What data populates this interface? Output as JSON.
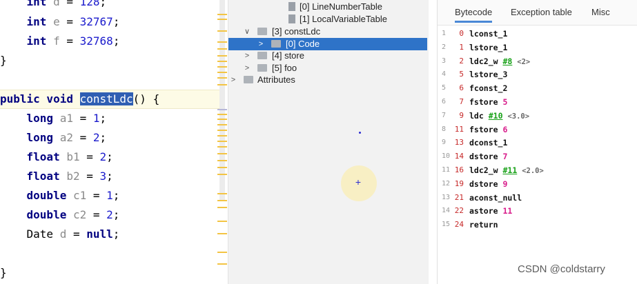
{
  "editor": {
    "lines": [
      {
        "kw": "int",
        "var": "d",
        "val": "128"
      },
      {
        "kw": "int",
        "var": "e",
        "val": "32767"
      },
      {
        "kw": "int",
        "var": "f",
        "val": "32768"
      }
    ],
    "close_brace": "}",
    "method_kw": "public void",
    "method_name": "constLdc",
    "method_tail": "() {",
    "body": [
      {
        "kw": "long",
        "var": "a1",
        "val": "1"
      },
      {
        "kw": "long",
        "var": "a2",
        "val": "2"
      },
      {
        "kw": "float",
        "var": "b1",
        "val": "2"
      },
      {
        "kw": "float",
        "var": "b2",
        "val": "3"
      },
      {
        "kw": "double",
        "var": "c1",
        "val": "1"
      },
      {
        "kw": "double",
        "var": "c2",
        "val": "2"
      },
      {
        "type": "Date",
        "var": "d",
        "val": "null"
      }
    ],
    "end_brace": "}",
    "assign": "=",
    "semicolon": ";"
  },
  "tree": {
    "items": [
      {
        "label": "[0] LineNumberTable",
        "arrow": ""
      },
      {
        "label": "[1] LocalVariableTable",
        "arrow": ""
      },
      {
        "label": "[3] constLdc",
        "arrow": "∨"
      },
      {
        "label": "[0] Code",
        "arrow": ">"
      },
      {
        "label": "[4] store",
        "arrow": ">"
      },
      {
        "label": "[5] foo",
        "arrow": ">"
      },
      {
        "label": "Attributes",
        "arrow": ">"
      }
    ]
  },
  "cursor": {
    "symbol": "+"
  },
  "bytecode_panel": {
    "tabs": [
      "Bytecode",
      "Exception table",
      "Misc"
    ],
    "active_tab": "Bytecode",
    "instructions": [
      {
        "line": "1",
        "offset": "0",
        "op": "lconst_1"
      },
      {
        "line": "2",
        "offset": "1",
        "op": "lstore_1"
      },
      {
        "line": "3",
        "offset": "2",
        "op": "ldc2_w",
        "ref": "#8",
        "comment": "<2>"
      },
      {
        "line": "4",
        "offset": "5",
        "op": "lstore_3"
      },
      {
        "line": "5",
        "offset": "6",
        "op": "fconst_2"
      },
      {
        "line": "6",
        "offset": "7",
        "op": "fstore",
        "arg": "5"
      },
      {
        "line": "7",
        "offset": "9",
        "op": "ldc",
        "ref": "#10",
        "comment": "<3.0>"
      },
      {
        "line": "8",
        "offset": "11",
        "op": "fstore",
        "arg": "6"
      },
      {
        "line": "9",
        "offset": "13",
        "op": "dconst_1"
      },
      {
        "line": "10",
        "offset": "14",
        "op": "dstore",
        "arg": "7"
      },
      {
        "line": "11",
        "offset": "16",
        "op": "ldc2_w",
        "ref": "#11",
        "comment": "<2.0>"
      },
      {
        "line": "12",
        "offset": "19",
        "op": "dstore",
        "arg": "9"
      },
      {
        "line": "13",
        "offset": "21",
        "op": "aconst_null"
      },
      {
        "line": "14",
        "offset": "22",
        "op": "astore",
        "arg": "11"
      },
      {
        "line": "15",
        "offset": "24",
        "op": "return"
      }
    ]
  },
  "watermark": "CSDN @coldstarry",
  "colors": {
    "selection": "#2e73c8",
    "keyword": "#000080",
    "offset": "#c62828",
    "reference": "#16a016",
    "argument": "#d81b8a"
  }
}
